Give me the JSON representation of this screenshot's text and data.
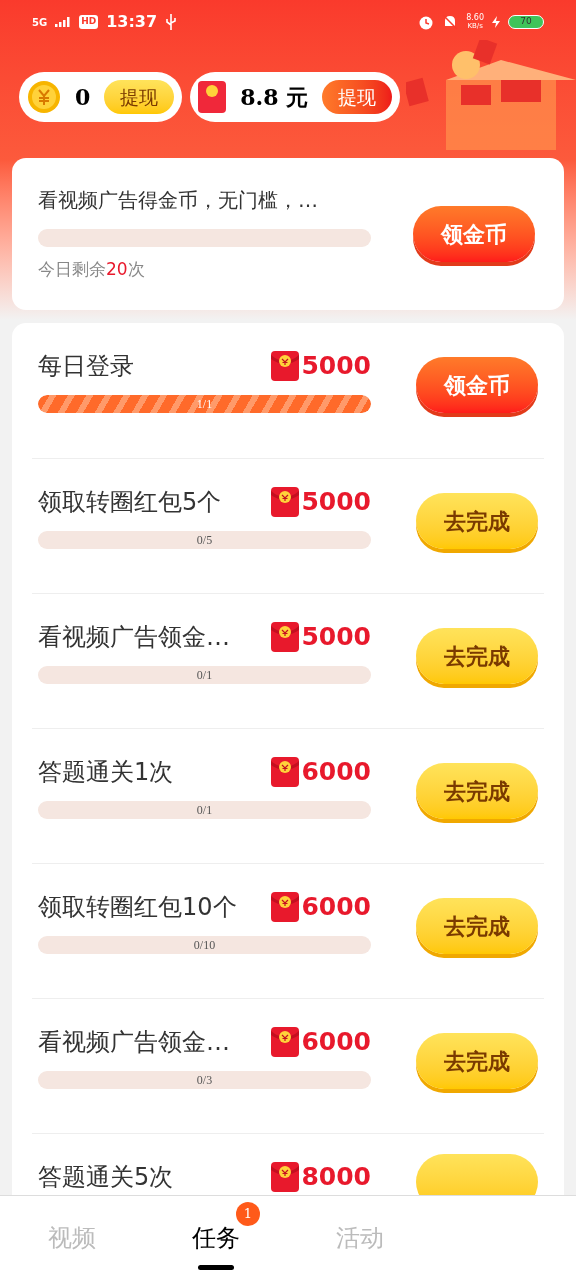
{
  "status_bar": {
    "network": "5G",
    "hd": "HD",
    "time": "13:37",
    "speed": "8.60",
    "speed_unit": "KB/s",
    "battery": "70"
  },
  "wallet": [
    {
      "kind": "coin",
      "amount": "0",
      "button": "提现"
    },
    {
      "kind": "cash",
      "amount": "8.8 元",
      "button": "提现"
    }
  ],
  "video_card": {
    "title": "看视频广告得金币，无门槛，…",
    "level": 0,
    "remaining_prefix": "今日剩余",
    "remaining_count": "20",
    "remaining_suffix": "次",
    "button": "领金币"
  },
  "tasks": [
    {
      "title": "每日登录",
      "reward": "5000",
      "level": 1,
      "progress": "1/1",
      "button": {
        "kind": "claim",
        "label": "领金币"
      }
    },
    {
      "title": "领取转圈红包5个",
      "reward": "5000",
      "level": 0,
      "progress": "0/5",
      "button": {
        "kind": "todo",
        "label": "去完成"
      }
    },
    {
      "title": "看视频广告领金…",
      "reward": "5000",
      "level": 0,
      "progress": "0/1",
      "button": {
        "kind": "todo",
        "label": "去完成"
      }
    },
    {
      "title": "答题通关1次",
      "reward": "6000",
      "level": 0,
      "progress": "0/1",
      "button": {
        "kind": "todo",
        "label": "去完成"
      }
    },
    {
      "title": "领取转圈红包10个",
      "reward": "6000",
      "level": 0,
      "progress": "0/10",
      "button": {
        "kind": "todo",
        "label": "去完成"
      }
    },
    {
      "title": "看视频广告领金…",
      "reward": "6000",
      "level": 0,
      "progress": "0/3",
      "button": {
        "kind": "todo",
        "label": "去完成"
      }
    },
    {
      "title": "答题通关5次",
      "reward": "8000",
      "button": {
        "kind": "todo"
      }
    }
  ],
  "nav": [
    {
      "label": "视频",
      "selected": false
    },
    {
      "label": "任务",
      "selected": true,
      "badge": "1"
    },
    {
      "label": "活动",
      "selected": false
    }
  ]
}
